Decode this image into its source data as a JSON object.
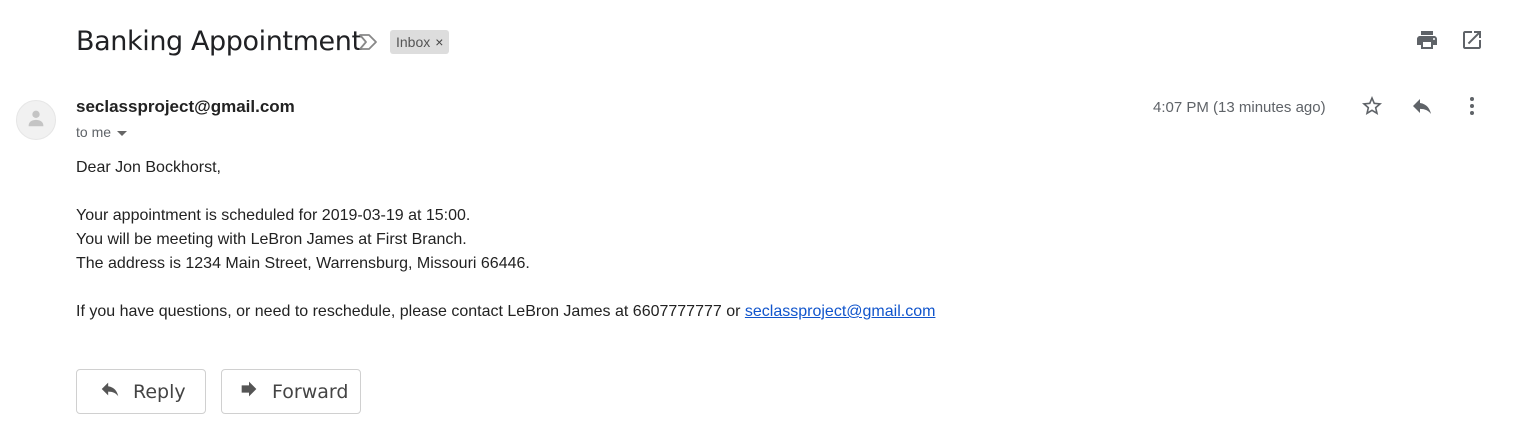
{
  "email": {
    "subject": "Banking Appointment",
    "label": "Inbox",
    "label_close": "×",
    "sender": "seclassproject@gmail.com",
    "recipient": "to me",
    "timestamp": "4:07 PM (13 minutes ago)",
    "body": {
      "greeting": "Dear Jon Bockhorst,",
      "line1": "Your appointment is scheduled for 2019-03-19 at 15:00.",
      "line2": "You will be meeting with LeBron James at First Branch.",
      "line3": "The address is 1234 Main Street, Warrensburg, Missouri 66446.",
      "contact_text": "If you have questions, or need to reschedule, please contact LeBron James at 6607777777 or ",
      "contact_email": "seclassproject@gmail.com"
    }
  },
  "actions": {
    "reply_label": "Reply",
    "forward_label": "Forward"
  },
  "icons": {
    "header": [
      "importance-marker-icon",
      "print-icon",
      "open-in-new-window-icon"
    ],
    "message": [
      "avatar-person-icon",
      "star-icon",
      "reply-icon",
      "more-vert-icon",
      "forward-icon"
    ]
  },
  "colors": {
    "text": "#222222",
    "secondary_text": "#5f6368",
    "link": "#1155cc",
    "label_chip_bg": "#dddddd",
    "icon": "#5f6368"
  }
}
